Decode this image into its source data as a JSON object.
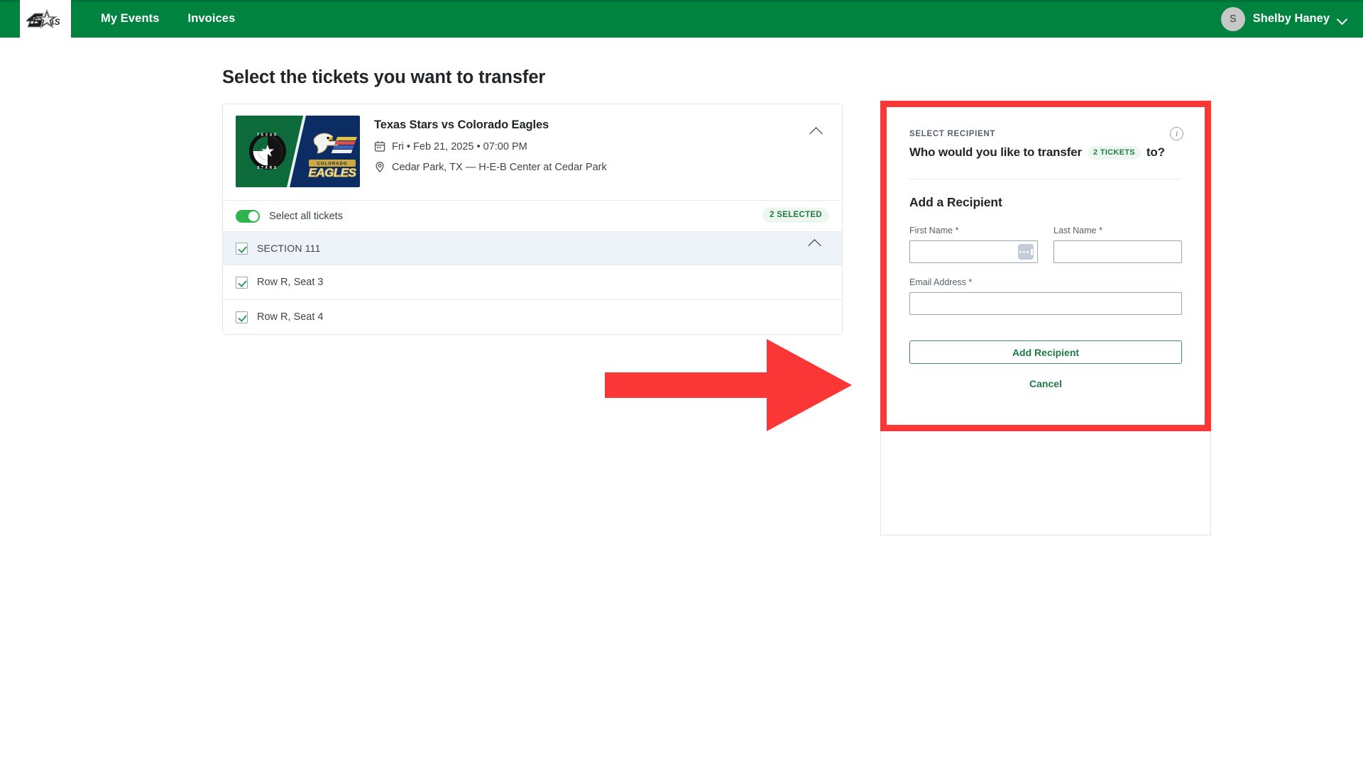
{
  "nav": {
    "logo_alt": "Texas Stars",
    "links": [
      {
        "label": "My Events"
      },
      {
        "label": "Invoices"
      }
    ],
    "user": {
      "initial": "S",
      "name": "Shelby Haney",
      "chevron": "chevron-down-icon"
    },
    "bar_color": "#00833e"
  },
  "page": {
    "title": "Select the tickets you want to transfer"
  },
  "event": {
    "name": "Texas Stars vs Colorado Eagles",
    "date": "Fri • Feb 21, 2025 • 07:00 PM",
    "venue": "Cedar Park, TX — H-E-B Center at Cedar Park",
    "date_icon": "calendar-icon",
    "venue_icon": "location-pin-icon",
    "collapse_icon": "chevron-up-icon",
    "home_team": "TEXAS STARS",
    "away_team": "COLORADO EAGLES"
  },
  "tickets": {
    "select_all_label": "Select all tickets",
    "selected_badge": "2 SELECTED",
    "toggle_on": true,
    "section": {
      "label": "SECTION 111",
      "checked": true,
      "collapse_icon": "chevron-up-icon"
    },
    "seats": [
      {
        "label": "Row R, Seat 3",
        "checked": true
      },
      {
        "label": "Row R, Seat 4",
        "checked": true
      }
    ]
  },
  "recipient_panel": {
    "kicker": "SELECT RECIPIENT",
    "info_icon": "info-icon",
    "info_glyph": "i",
    "question_before": "Who would you like to transfer",
    "tickets_badge": "2 TICKETS",
    "question_after": "to?",
    "subtitle": "Add a Recipient",
    "fields": {
      "first_name": {
        "label": "First Name",
        "required_mark": "*",
        "value": "",
        "placeholder": ""
      },
      "last_name": {
        "label": "Last Name",
        "required_mark": "*",
        "value": "",
        "placeholder": ""
      },
      "email": {
        "label": "Email Address",
        "required_mark": "*",
        "value": "",
        "placeholder": ""
      }
    },
    "autofill_icon": "password-manager-autofill-icon",
    "add_button": "Add Recipient",
    "cancel_button": "Cancel"
  },
  "annotation": {
    "arrow_icon": "red-right-arrow-annotation",
    "highlight_icon": "red-rectangle-highlight-annotation",
    "color": "#fb3636"
  },
  "colors": {
    "brand_green": "#00833e",
    "accent_green": "#1f7a46",
    "toggle_green": "#2eb44c",
    "annotation_red": "#fb3636",
    "section_row_bg": "#eef3fa"
  }
}
